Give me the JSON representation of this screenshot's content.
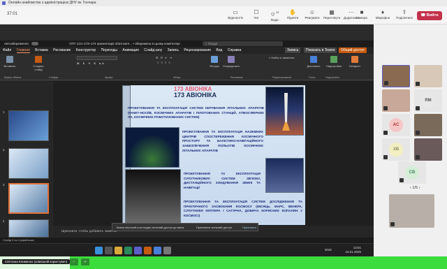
{
  "teams": {
    "window_title": "Онлайн-знайомство з адміністрацією ДНУ ім. Гончара",
    "timer": "37:01",
    "toolbar": [
      {
        "label": "Відеопотік",
        "icon": "video-stream-icon"
      },
      {
        "label": "Чат",
        "icon": "chat-icon"
      },
      {
        "label": "Люди",
        "icon": "people-icon",
        "badge": "29"
      },
      {
        "label": "Підняти",
        "icon": "raise-hand-icon"
      },
      {
        "label": "Реагувати",
        "icon": "react-icon"
      },
      {
        "label": "Перегляути",
        "icon": "view-icon"
      },
      {
        "label": "Додатково",
        "icon": "more-icon"
      },
      {
        "label": "Камера",
        "icon": "camera-icon"
      },
      {
        "label": "Мікрофон",
        "icon": "microphone-icon"
      },
      {
        "label": "Поділитися",
        "icon": "share-icon"
      }
    ],
    "leave_label": "Вийти",
    "leave_color": "#c4314b"
  },
  "powerpoint": {
    "title_left": "Автозбереження",
    "title_file": "ОП7 121+173+174 презентація 2023 англ... • Збережено в цьому комп'ютері",
    "search_placeholder": "Пошук",
    "menu": [
      "Файл",
      "Главная",
      "Вставка",
      "Рисование",
      "Конструктор",
      "Переходы",
      "Анимация",
      "Слайд-шоу",
      "Запись",
      "Рецензирование",
      "Вид",
      "Справка"
    ],
    "menu_active": "Главная",
    "right_buttons": [
      "Запись",
      "Показать в Teams",
      "Общий доступ"
    ],
    "ribbon_groups": [
      {
        "label": "Вставить",
        "group": "Буфер обмена"
      },
      {
        "label": "Создать слайд",
        "group": "Слайды"
      },
      {
        "label": "Шрифт",
        "group": "Шрифт"
      },
      {
        "label": "Абзац",
        "group": "Абзац"
      },
      {
        "label": "Фигуры",
        "group": "Рисование"
      },
      {
        "label": "Упорядочить",
        "group": ""
      },
      {
        "label": "Найти и заменить",
        "group": "Редактирование"
      },
      {
        "label": "Диктовать",
        "group": "Голос"
      },
      {
        "label": "Надстройки",
        "group": "Надстройки"
      },
      {
        "label": "Designer",
        "group": ""
      }
    ],
    "thumb_numbers": [
      "1",
      "2",
      "3",
      "4"
    ],
    "notes_placeholder": "Щоконити, чтобы добавить заметки",
    "notify_text": "teams.microsoft.com надає спільний доступ до вікна.",
    "notify_action": "Припинити спільний доступ",
    "notify_hide": "Приховати",
    "status": "Слайд 3 из 4   українська",
    "slide": {
      "title_red": "173 АВІОНІКА",
      "title": "173 АВІОНІКА",
      "p1": "ПРОЕКТУВАННЯ ТА ЕКСПЛУАТАЦІЯ СИСТЕМ КЕРУВАННЯ ЛІТАЛЬНИХ АПАРАТІВ (РАКЕТ-НОСІЇВ, КОСМІЧНИХ АПАРАТІВ І ПІЛОТОВАНИХ СТАНЦІЙ, АТМОСФЕРНИХ ЛА, КОСМІЧНИХ РОБОТИЗОВАНИХ СИСТЕМ)",
      "p2": "ПРОЕКТУВАННЯ ТА ЕКСПЛУАТАЦІЯ НАЗЕМНИХ ЦЕНТРІВ СПОСТЕРЕЖЕННЯ КОСМІЧНОГО ПРОСТОРУ ТА БАЛІСТИКО-НАВІГАЦІЙНОГО ЗАБЕЗПЕЧЕННЯ ПОЛЬОТІВ КОСМІЧНИХ ЛІТАЛЬНИХ АПАРАТІВ",
      "p3": "ПРОЕКТУВАННЯ ТА ЕКСПЛУАТАЦІЯ СУПУТНИКОВИХ СИСТЕМ ЗВ'ЯЗКУ, ДИСТАНЦІЙНОГО ЗОНДУВАННЯ ЗЕМЛІ ТА НАВІГАЦІЇ",
      "p4": "ПРОЕКТУВАННЯ ТА ЕКСПЛУАТАЦІЯ СИСТЕМ ДОСЛІДЖЕННЯ ТА ПРАКТИЧНОГО ЗАСВОЄННЯ КОСМОСУ (МІСЯЦЬ, МАРС, ВЕНЕРА, СУПУТНИКИ ЮПІТЕРА І САТУРНА, ДОБИЧА КОРИСНИХ КОПАЛИН У КОСМОСІ)"
    }
  },
  "taskbar": {
    "lang": "ENG",
    "time": "13:51",
    "date": "15.01.2025"
  },
  "participants": {
    "tiles": [
      {
        "initials": "AC",
        "color": "#f5c6c6",
        "text": "#a33"
      },
      {
        "initials": "XB",
        "color": "#f3efc2",
        "text": "#886"
      },
      {
        "initials": "CB",
        "color": "#d6ecd6",
        "text": "#486"
      },
      {
        "initials": "RM",
        "color": "#e8e8e8",
        "text": "#555"
      }
    ],
    "pager": "1/5"
  },
  "bottom": {
    "presenter_name": "Світлана Клименко (зовнішній користувач)"
  }
}
